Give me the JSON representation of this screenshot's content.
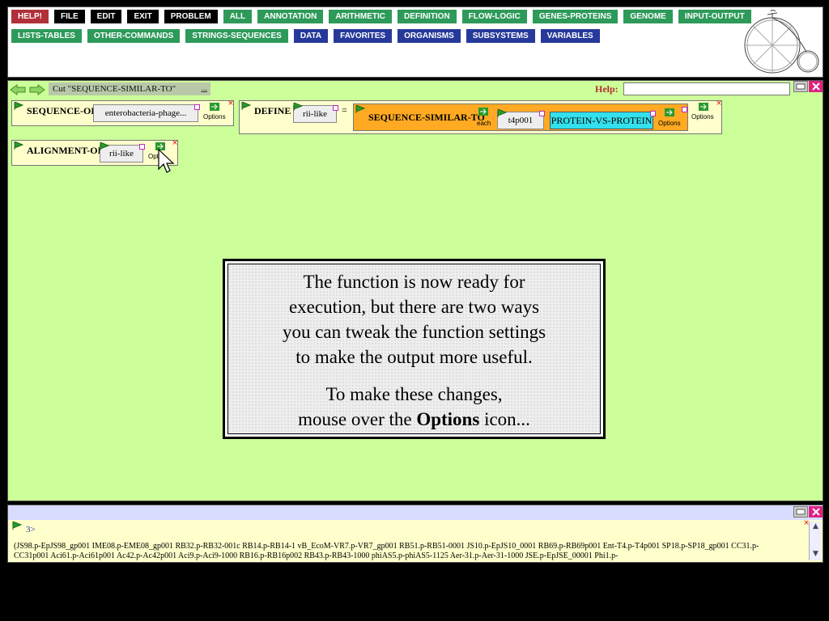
{
  "menu": {
    "row1": [
      {
        "label": "HELP!",
        "color": "red"
      },
      {
        "label": "FILE",
        "color": "black"
      },
      {
        "label": "EDIT",
        "color": "black"
      },
      {
        "label": "EXIT",
        "color": "black"
      },
      {
        "label": "PROBLEM",
        "color": "black"
      },
      {
        "label": "ALL",
        "color": "green"
      },
      {
        "label": "ANNOTATION",
        "color": "green"
      },
      {
        "label": "ARITHMETIC",
        "color": "green"
      },
      {
        "label": "DEFINITION",
        "color": "green"
      },
      {
        "label": "FLOW-LOGIC",
        "color": "green"
      },
      {
        "label": "GENES-PROTEINS",
        "color": "green"
      },
      {
        "label": "GENOME",
        "color": "green"
      },
      {
        "label": "INPUT-OUTPUT",
        "color": "green"
      }
    ],
    "row2": [
      {
        "label": "LISTS-TABLES",
        "color": "green"
      },
      {
        "label": "OTHER-COMMANDS",
        "color": "green"
      },
      {
        "label": "STRINGS-SEQUENCES",
        "color": "green"
      },
      {
        "label": "DATA",
        "color": "blue"
      },
      {
        "label": "FAVORITES",
        "color": "blue"
      },
      {
        "label": "ORGANISMS",
        "color": "blue"
      },
      {
        "label": "SUBSYSTEMS",
        "color": "blue"
      },
      {
        "label": "VARIABLES",
        "color": "blue"
      }
    ]
  },
  "workspace": {
    "cut_label": "Cut \"SEQUENCE-SIMILAR-TO\"",
    "cut_more": "...",
    "help_label": "Help:",
    "help_value": "",
    "colors": {
      "background": "#ccff99",
      "function_box": "#ffffcc",
      "highlight_box": "#ffaa22",
      "selected_slot": "#33e0ee"
    }
  },
  "boxes": {
    "sequence_of": {
      "name": "SEQUENCE-OF",
      "arg": "enterobacteria-phage...",
      "options": "Options"
    },
    "define": {
      "name": "DEFINE",
      "var": "rii-like",
      "equals": "=",
      "options": "Options",
      "inner": {
        "name": "SEQUENCE-SIMILAR-TO",
        "each": "each",
        "arg": "t4p001",
        "mode": "PROTEIN-VS-PROTEIN",
        "options": "Options"
      }
    },
    "alignment_of": {
      "name": "ALIGNMENT-OF",
      "arg": "rii-like",
      "options": "Opti"
    }
  },
  "tutorial": {
    "line1": "The function is now ready for",
    "line2": "execution, but there are two ways",
    "line3": "you can tweak the function settings",
    "line4": "to make the output more useful.",
    "line5": "To make these changes,",
    "line6_pre": "mouse over the ",
    "line6_bold": "Options",
    "line6_post": " icon..."
  },
  "output": {
    "prompt": "3>",
    "text": "(JS98.p-EpJS98_gp001 IME08.p-EME08_gp001 RB32.p-RB32-001c RB14.p-RB14-1 vB_EcoM-VR7.p-VR7_gp001 RB51.p-RB51-0001 JS10.p-EpJS10_0001 RB69.p-RB69p001 Ent-T4.p-T4p001 SP18.p-SP18_gp001 CC31.p-CC31p001 Aci61.p-Aci61p001 Ac42.p-Ac42p001 Aci9.p-Aci9-1000 RB16.p-RB16p002 RB43.p-RB43-1000 phiAS5.p-phiAS5-1125 Aer-31.p-Aer-31-1000 JSE.p-EpJSE_00001 Phi1.p-"
  }
}
